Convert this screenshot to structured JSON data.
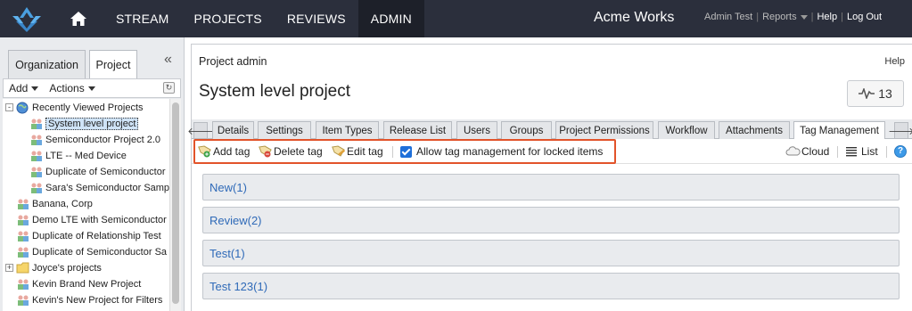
{
  "nav": {
    "items": [
      "STREAM",
      "PROJECTS",
      "REVIEWS",
      "ADMIN"
    ],
    "active": "ADMIN",
    "brand": "Acme Works",
    "user": "Admin Test",
    "reports": "Reports",
    "help": "Help",
    "logout": "Log Out"
  },
  "left": {
    "tabs": [
      "Organization",
      "Project"
    ],
    "active_tab": "Project",
    "toolbar": {
      "add": "Add",
      "actions": "Actions"
    },
    "tree": [
      {
        "label": "Recently Viewed Projects",
        "icon": "globe-icon",
        "level": 0,
        "expander": "-"
      },
      {
        "label": "System level project",
        "icon": "project-icon",
        "level": 1,
        "selected": true
      },
      {
        "label": "Semiconductor Project 2.0",
        "icon": "project-icon",
        "level": 1
      },
      {
        "label": "LTE -- Med Device",
        "icon": "project-icon",
        "level": 1
      },
      {
        "label": "Duplicate of Semiconductor",
        "icon": "project-icon",
        "level": 1
      },
      {
        "label": "Sara's Semiconductor Samp",
        "icon": "project-icon",
        "level": 1
      },
      {
        "label": "Banana, Corp",
        "icon": "project-icon",
        "level": 0
      },
      {
        "label": "Demo LTE with Semiconductor",
        "icon": "project-icon",
        "level": 0
      },
      {
        "label": "Duplicate of Relationship Test",
        "icon": "project-icon",
        "level": 0
      },
      {
        "label": "Duplicate of Semiconductor Sa",
        "icon": "project-icon",
        "level": 0
      },
      {
        "label": "Joyce's projects",
        "icon": "folder-icon",
        "level": 0,
        "expander": "+"
      },
      {
        "label": "Kevin Brand New Project",
        "icon": "project-icon",
        "level": 0
      },
      {
        "label": "Kevin's New Project for Filters",
        "icon": "project-icon",
        "level": 0
      }
    ]
  },
  "main": {
    "breadcrumb": "Project admin",
    "help": "Help",
    "title": "System level project",
    "activity_count": "13",
    "tabs": [
      "Details",
      "Settings",
      "Item Types",
      "Release List",
      "Users",
      "Groups",
      "Project Permissions",
      "Workflow",
      "Attachments",
      "Tag Management"
    ],
    "active_tab": "Tag Management",
    "actions": {
      "add_tag": "Add tag",
      "delete_tag": "Delete tag",
      "edit_tag": "Edit tag",
      "allow_locked": "Allow tag management for locked items",
      "allow_locked_checked": true,
      "cloud": "Cloud",
      "list": "List"
    },
    "tags": [
      "New(1)",
      "Review(2)",
      "Test(1)",
      "Test 123(1)"
    ]
  }
}
